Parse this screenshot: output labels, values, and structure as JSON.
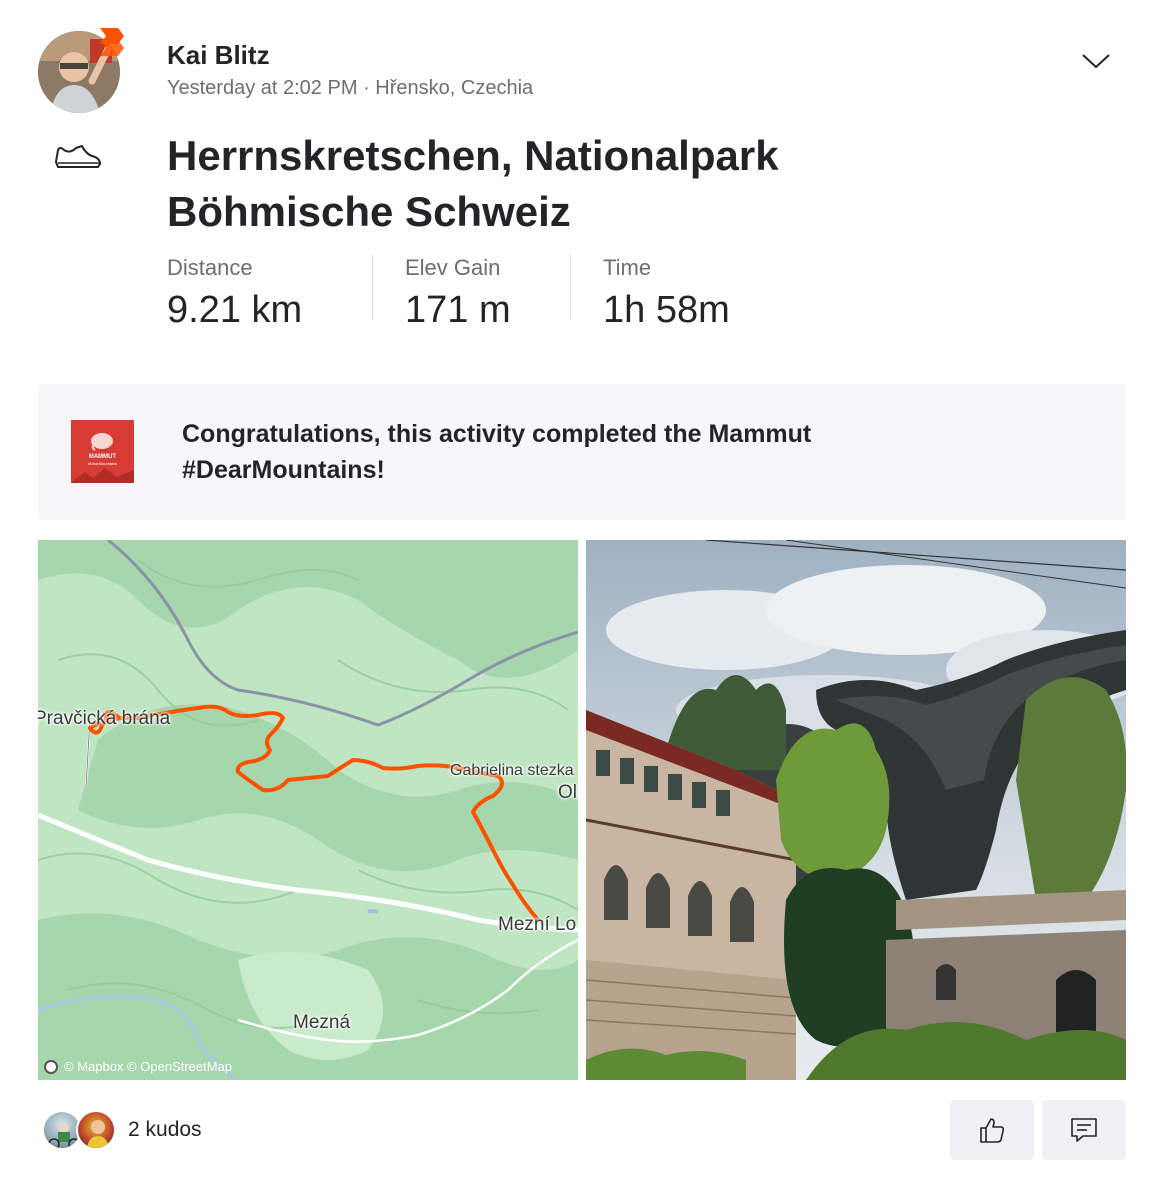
{
  "athlete": {
    "name": "Kai Blitz",
    "timestamp": "Yesterday at 2:02 PM",
    "separator": "·",
    "location": "Hřensko, Czechia",
    "avatar_icon": "user-photo",
    "badge_icon": "subscriber-badge",
    "badge_color": "#fc5200"
  },
  "activity": {
    "sport_icon": "hiking-shoe-icon",
    "title": "Herrnskretschen, Nationalpark Böhmische Schweiz",
    "stats": [
      {
        "label": "Distance",
        "value": "9.21 km"
      },
      {
        "label": "Elev Gain",
        "value": "171 m"
      },
      {
        "label": "Time",
        "value": "1h 58m"
      }
    ]
  },
  "challenge": {
    "text": "Congratulations, this activity completed the Mammut #DearMountains!",
    "logo_text": "MAMMUT",
    "logo_subtext": "#DearMountains",
    "logo_color": "#d83a34"
  },
  "map": {
    "labels": {
      "pravcicka": "Pravčická brána",
      "gabrielina": "Gabrielina stezka",
      "mezni_louka": "Mezní Lo",
      "mezna": "Mezná",
      "edge_label": "Ol"
    },
    "attribution": "© Mapbox © OpenStreetMap",
    "route_color": "#fc5200",
    "land_color": "#bfe5c3",
    "forest_color": "#a3d5a8"
  },
  "photo": {
    "subject": "Pravčická brána sandstone arch with Falkenhorst chalet",
    "sky_color": "#c9d3dc"
  },
  "kudos": {
    "count_text": "2 kudos"
  },
  "actions": {
    "kudos_icon": "thumbs-up-icon",
    "comment_icon": "comment-icon"
  }
}
